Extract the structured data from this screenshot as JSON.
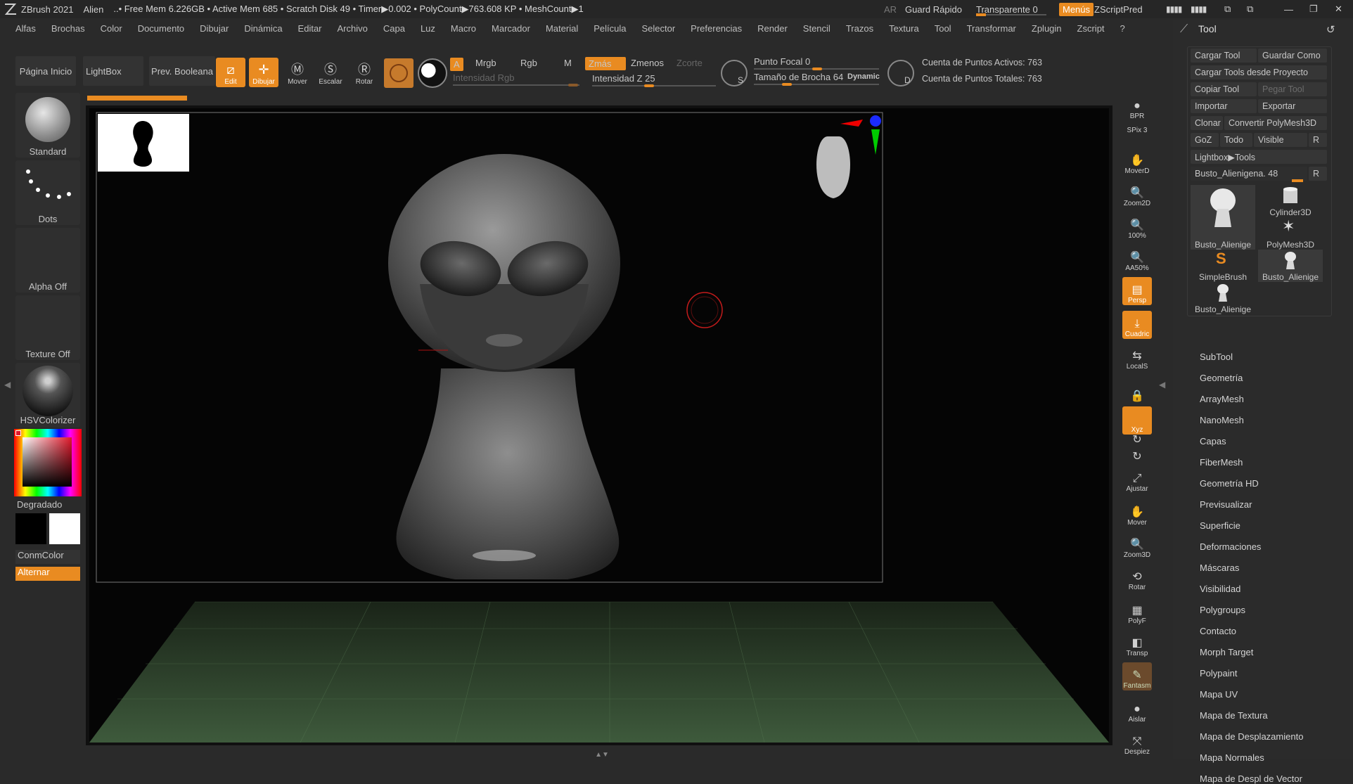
{
  "titlebar": {
    "app": "ZBrush 2021",
    "doc": "Alien",
    "stats": "..• Free Mem 6.226GB • Active Mem 685 • Scratch Disk 49 •  Timer▶0.002 • PolyCount▶763.608 KP • MeshCount▶1",
    "ar": "AR",
    "quicksave": "Guard Rápido",
    "transparent": "Transparente 0",
    "menus": "Menús",
    "zscript": "ZScriptPred"
  },
  "menubar": [
    "Alfas",
    "Brochas",
    "Color",
    "Documento",
    "Dibujar",
    "Dinámica",
    "Editar",
    "Archivo",
    "Capa",
    "Luz",
    "Macro",
    "Marcador",
    "Material",
    "Película",
    "Selector",
    "Preferencias",
    "Render",
    "Stencil",
    "Trazos",
    "Textura",
    "Tool",
    "Transformar",
    "Zplugin",
    "Zscript",
    "?"
  ],
  "toolbar": {
    "home": "Página Inicio",
    "lightbox": "LightBox",
    "boolean": "Prev. Booleana",
    "edit": "Edit",
    "draw": "Dibujar",
    "move": "Mover",
    "scale": "Escalar",
    "rotate": "Rotar",
    "a": "A",
    "mrgb": "Mrgb",
    "rgb": "Rgb",
    "m": "M",
    "zadd": "Zmás",
    "zsub": "Zmenos",
    "zcut": "Zcorte",
    "rgb_intensity": "Intensidad Rgb",
    "z_intensity": "Intensidad Z 25",
    "focal": "Punto Focal 0",
    "brush_size": "Tamaño de Brocha 64",
    "dynamic": "Dynamic",
    "active_points": "Cuenta de Puntos Activos: 763",
    "total_points": "Cuenta de Puntos Totales: 763",
    "s_label": "S",
    "d_label": "D"
  },
  "leftshelf": {
    "brush": "Standard",
    "stroke": "Dots",
    "alpha": "Alpha Off",
    "texture": "Texture Off",
    "material": "HSVColorizer",
    "gradient": "Degradado",
    "switch": "ConmColor",
    "alternate": "Alternar"
  },
  "rightshelf": [
    "BPR",
    "SPix 3",
    "MoverD",
    "Zoom2D",
    "100%",
    "AA50%",
    "Persp",
    "Cuadric",
    "LocalS",
    "",
    "Xyz",
    "",
    "",
    "Ajustar",
    "Mover",
    "Zoom3D",
    "Rotar",
    "PolyF",
    "Transp",
    "Fantasm",
    "Aislar",
    "Despiez"
  ],
  "toolpanel": {
    "title": "Tool",
    "load": "Cargar Tool",
    "save_as": "Guardar Como",
    "load_project": "Cargar Tools desde Proyecto",
    "copy": "Copiar Tool",
    "paste": "Pegar Tool",
    "import": "Importar",
    "export": "Exportar",
    "clone": "Clonar",
    "convert": "Convertir PolyMesh3D",
    "goz": "GoZ",
    "all": "Todo",
    "visible": "Visible",
    "r": "R",
    "lightbox_tools": "Lightbox▶Tools",
    "current": "Busto_Alienigena. 48",
    "meshes": [
      "Busto_Alienige",
      "Cylinder3D",
      "PolyMesh3D",
      "SimpleBrush",
      "Busto_Alienige",
      "Busto_Alienige"
    ],
    "sections": [
      "SubTool",
      "Geometría",
      "ArrayMesh",
      "NanoMesh",
      "Capas",
      "FiberMesh",
      "Geometría HD",
      "Previsualizar",
      "Superficie",
      "Deformaciones",
      "Máscaras",
      "Visibilidad",
      "Polygroups",
      "Contacto",
      "Morph Target",
      "Polypaint",
      "Mapa UV",
      "Mapa de Textura",
      "Mapa de Desplazamiento",
      "Mapa Normales",
      "Mapa de Despl de Vector"
    ]
  },
  "colors": {
    "accent": "#e98b21",
    "bg": "#2a2a2a",
    "panel": "#2b2b2b",
    "canvas": "#050505",
    "brush_cursor": "#c21b1b"
  }
}
